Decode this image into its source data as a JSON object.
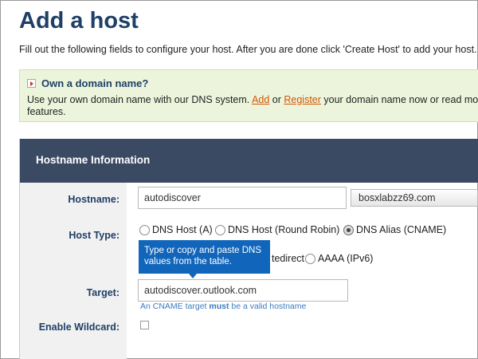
{
  "page": {
    "title": "Add a host",
    "intro": "Fill out the following fields to configure your host. After you are done click 'Create Host' to add your host."
  },
  "domain_box": {
    "icon": "arrow-right-icon",
    "heading": "Own a domain name?",
    "text_before": "Use your own domain name with our DNS system. ",
    "add_link": "Add",
    "text_or": " or ",
    "register_link": "Register",
    "text_after": " your domain name now or read more fo",
    "text_line2": "features."
  },
  "panel": {
    "header": "Hostname Information"
  },
  "form": {
    "hostname_label": "Hostname:",
    "hostname_value": "autodiscover",
    "domain_value": "bosxlabzz69.com",
    "host_type_label": "Host Type:",
    "host_types": [
      {
        "label": "DNS Host (A)",
        "checked": false
      },
      {
        "label": "DNS Host (Round Robin)",
        "checked": false
      },
      {
        "label": "DNS Alias (CNAME)",
        "checked": true
      }
    ],
    "host_types_row2": [
      {
        "label": "tedirect",
        "checked": false
      },
      {
        "label": "AAAA (IPv6)",
        "checked": false
      }
    ],
    "tooltip": "Type or copy and paste DNS values from the table.",
    "target_label": "Target:",
    "target_value": "autodiscover.outlook.com",
    "target_hint_before": "An CNAME target ",
    "target_hint_bold": "must",
    "target_hint_after": " be a valid hostname",
    "wildcard_label": "Enable Wildcard:",
    "wildcard_checked": false
  },
  "colors": {
    "title": "#1f3f67",
    "header_bg": "#3b4a63",
    "tooltip_bg": "#1166bb",
    "domain_bg": "#ecf5dc",
    "link": "#d35400",
    "hint": "#3a7cc0"
  }
}
